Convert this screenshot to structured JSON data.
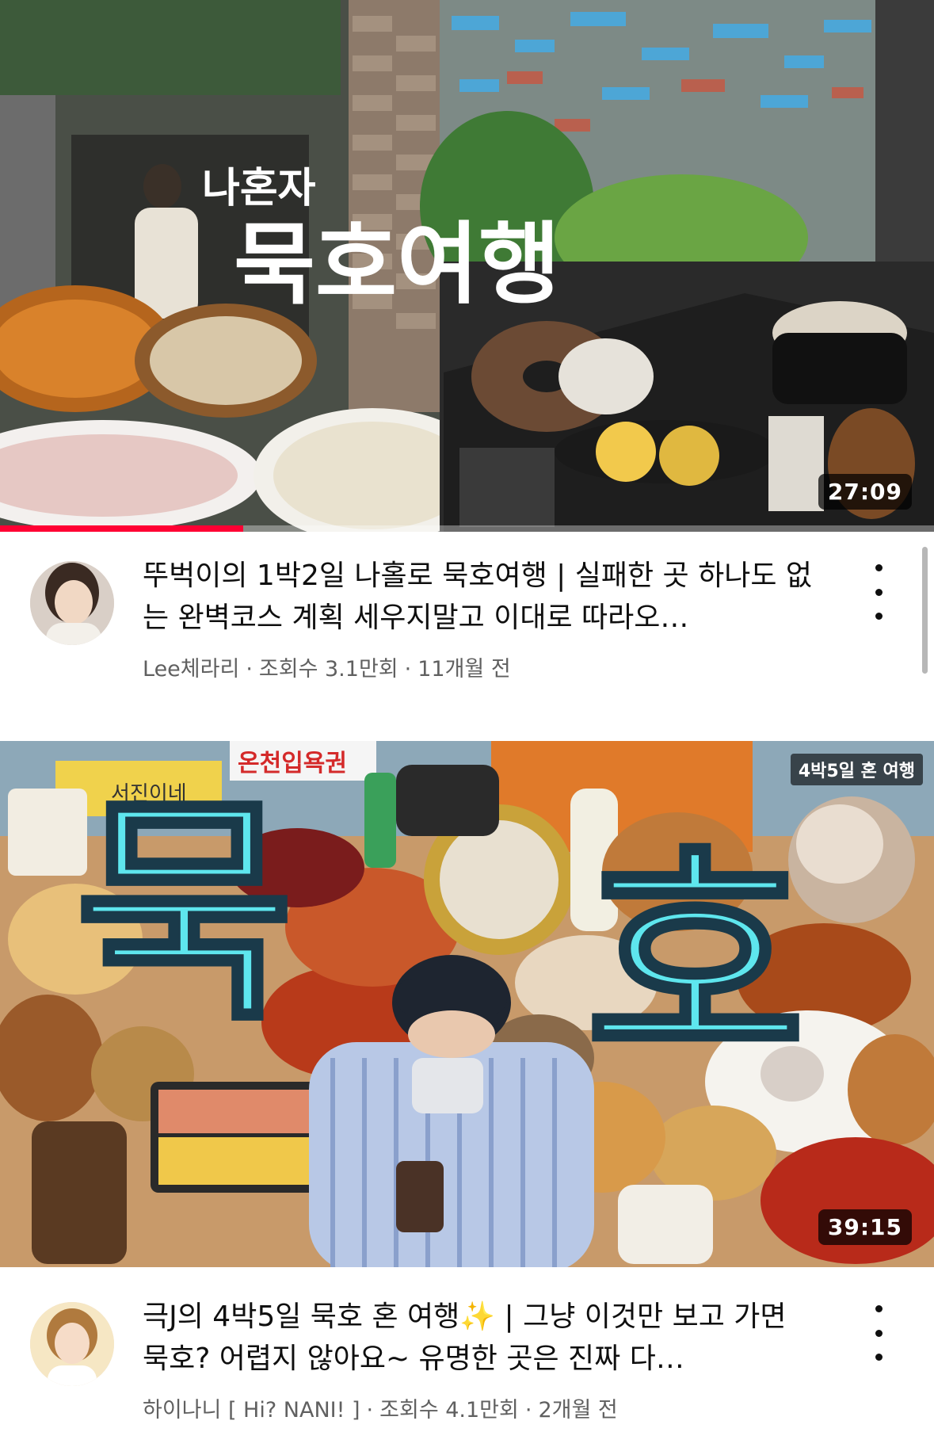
{
  "videos": [
    {
      "duration": "27:09",
      "watched_progress": 0.26,
      "thumbnail_text": {
        "small": "나혼자",
        "big": "묵호여행"
      },
      "title": "뚜벅이의 1박2일 나홀로 묵호여행 | 실패한 곳 하나도 없는 완벽코스 계획 세우지말고 이대로 따라오…",
      "channel": "Lee체라리",
      "views": "조회수 3.1만회",
      "age": "11개월 전",
      "sep": "·"
    },
    {
      "duration": "39:15",
      "thumbnail_text": {
        "big_left": "묵",
        "big_right": "호",
        "corner": "4박5일 혼 여행",
        "sign": "온천입욕권",
        "store": "서진이네"
      },
      "title": "극J의 4박5일 묵호 혼 여행✨ | 그냥 이것만 보고 가면 묵호? 어렵지 않아요~ 유명한 곳은 진짜 다…",
      "channel": "하이나니 [ Hi? NANI! ]",
      "views": "조회수 4.1만회",
      "age": "2개월 전",
      "sep": "·"
    }
  ],
  "colors": {
    "accent": "#ff0033",
    "thumb_text_cyan": "#5ee6ee"
  },
  "icons": {
    "more": "more-vert-icon"
  }
}
